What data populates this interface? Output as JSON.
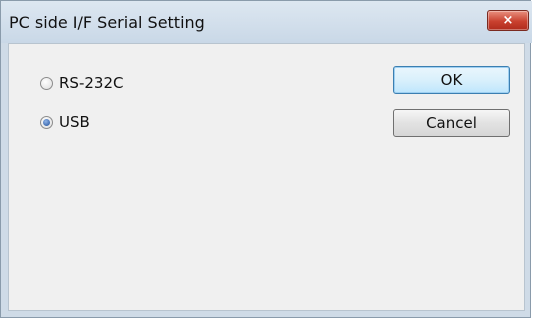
{
  "window": {
    "title": "PC side I/F Serial Setting",
    "close_glyph": "×"
  },
  "options": [
    {
      "label": "RS-232C",
      "selected": false
    },
    {
      "label": "USB",
      "selected": true
    }
  ],
  "buttons": {
    "ok_label": "OK",
    "cancel_label": "Cancel"
  }
}
